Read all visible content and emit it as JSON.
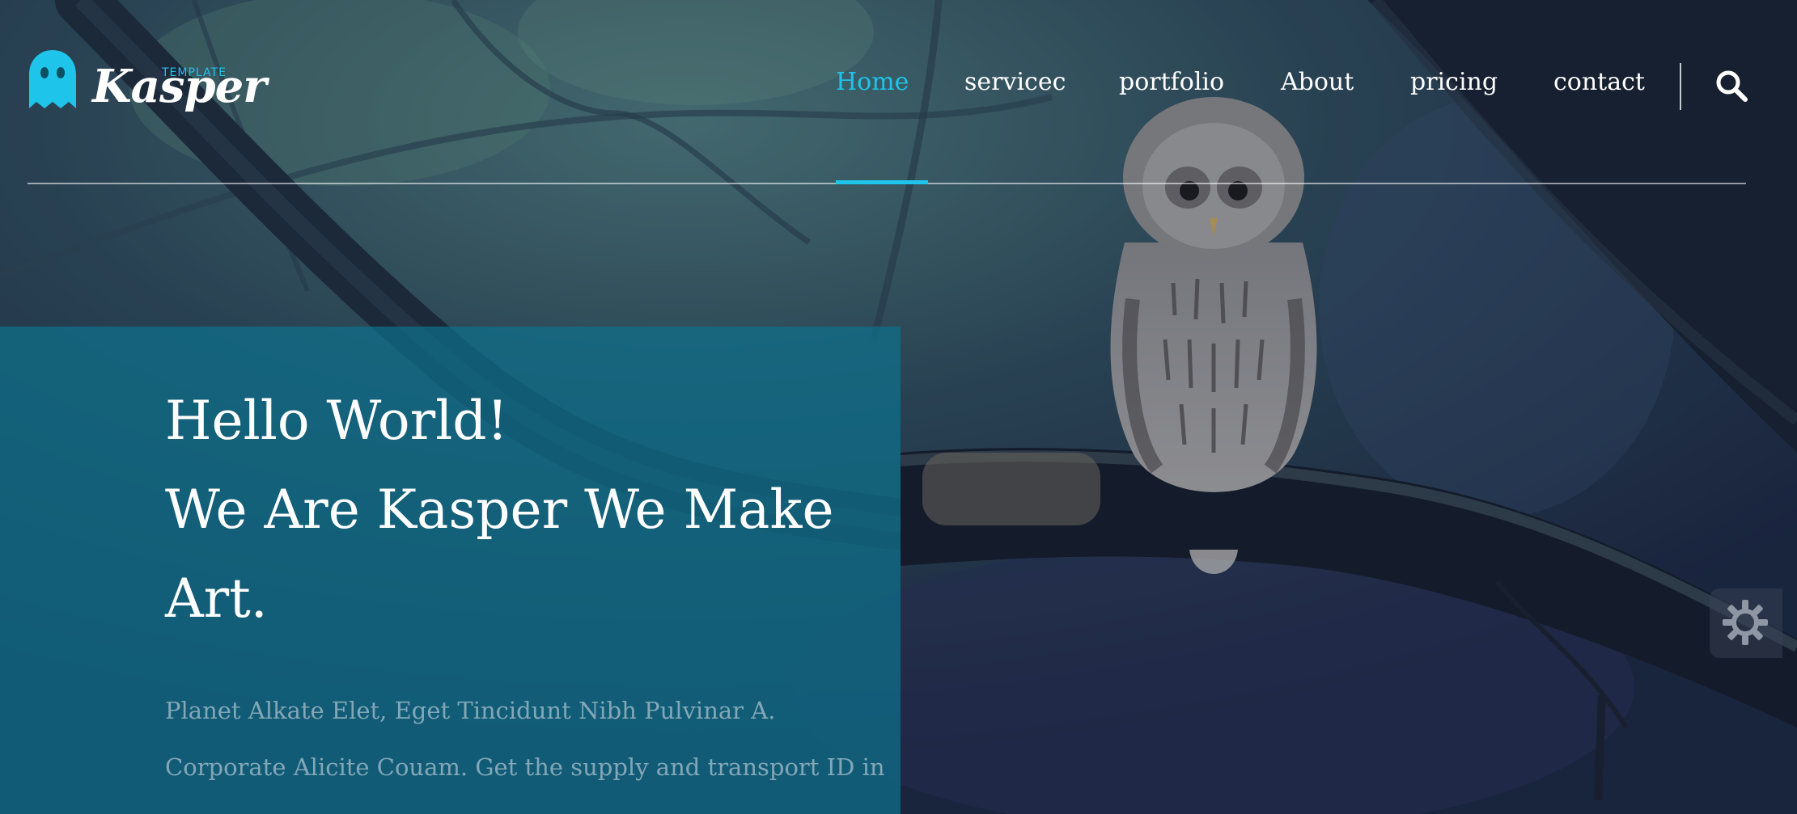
{
  "brand": {
    "name": "Kasper",
    "tag": "TEMPLATE",
    "logo_icon": "ghost-icon"
  },
  "nav": {
    "items": [
      {
        "label": "Home",
        "active": true
      },
      {
        "label": "servicec",
        "active": false
      },
      {
        "label": "portfolio",
        "active": false
      },
      {
        "label": "About",
        "active": false
      },
      {
        "label": "pricing",
        "active": false
      },
      {
        "label": "contact",
        "active": false
      }
    ],
    "search_icon": "search-icon",
    "accent_color": "#1fc4ea"
  },
  "hero": {
    "title_lines": [
      "Hello World!",
      "We Are Kasper We Make",
      "Art."
    ],
    "text_lines": [
      "Planet Alkate Elet, Eget Tincidunt Nibh Pulvinar A.",
      "Corporate Alicite Couam. Get the supply and transport ID in"
    ],
    "box_color": "#0e708c"
  },
  "settings": {
    "icon": "gear-icon"
  }
}
